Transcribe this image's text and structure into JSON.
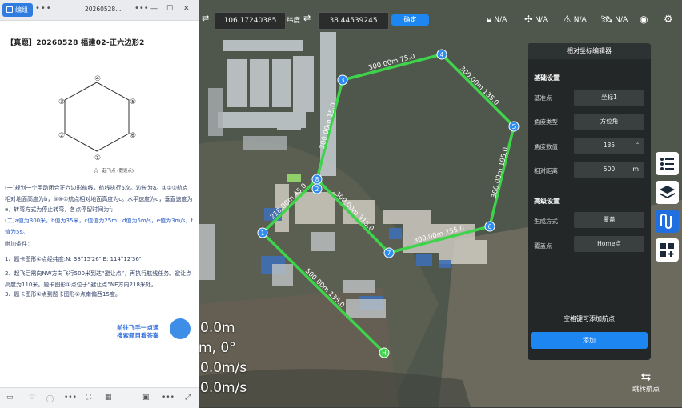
{
  "window": {
    "title": "20260528...",
    "edit_button": "编组",
    "menu_dots": "•••",
    "more_dots": "•••"
  },
  "doc": {
    "title": "【真题】20260528 福建02-正六边形2",
    "hex_labels": [
      "④",
      "③",
      "⑤",
      "②",
      "⑥",
      "①"
    ],
    "start_label": "起飞点 (假设点)",
    "para1": "(一)规划一个手动闭合正六边形航线，航线执行5次。边长为a。①②③航点相对地面高度为b，⑤⑥①航点相对地面高度为c。水平速度为d，垂直速度为e，转弯方式为停止转弯，各点停留时间为f;",
    "para2": "(二)a值为300米，b值为35米，c值值为25m，d值为5m/s，e值为3m/s，f值为5s。",
    "para3": "附加条件：",
    "para4": "1、题卡图形①点经纬度:N: 38°15′26″ E: 114°12′36″",
    "para5": "2、起飞后需向NW方向飞行500米到达“避让点”，再执行航线任务。避让点高度为110米。题卡图形①点位于“避让点”NE方向218米处。",
    "para6": "3、题卡图形①点到题卡图形②点南偏西15度。",
    "promo1": "前往飞手一点通",
    "promo2": "搜索题目看答案"
  },
  "topbar": {
    "longitude": "106.17240385",
    "latitude_label": "纬度",
    "latitude": "38.44539245",
    "confirm": "确定",
    "status": [
      "N/A",
      "N/A",
      "N/A",
      "N/A"
    ]
  },
  "editor": {
    "title": "相对坐标编辑器",
    "basic": "基础设置",
    "ref_label": "基准点",
    "ref_value": "坐标1",
    "angle_type_label": "角度类型",
    "angle_type_value": "方位角",
    "angle_label": "角度数值",
    "angle_value": "135",
    "dist_label": "相对距离",
    "dist_value": "500",
    "dist_unit": "m",
    "advanced": "高级设置",
    "gen_label": "生成方式",
    "gen_value": "覆盖",
    "overlay_label": "覆盖点",
    "overlay_value": "Home点",
    "hint": "空格键可添加航点",
    "add": "添加"
  },
  "hud": {
    "l1": "0.0m",
    "l2": "m, 0°",
    "l3": "0.0m/s",
    "l4": "0.0m/s"
  },
  "jump": "跳转航点",
  "route": {
    "points": [
      {
        "id": "1",
        "x": -18,
        "y": -45
      },
      {
        "id": "2",
        "x": -18,
        "y": -56
      },
      {
        "id": "3",
        "x": -18,
        "y": -63
      },
      {
        "id": "4",
        "x": -18,
        "y": -70
      },
      {
        "id": "5",
        "x": -18,
        "y": -76
      },
      {
        "id": "6",
        "x": -18,
        "y": -81
      },
      {
        "id": "7",
        "x": -18,
        "y": -87
      },
      {
        "id": "8",
        "x": -18,
        "y": -92
      },
      {
        "id": "H",
        "x": -18,
        "y": -97
      }
    ],
    "segments": [
      {
        "label": "300.00m 75.0"
      },
      {
        "label": "300.00m 135.0"
      },
      {
        "label": "300.00m 195.0"
      },
      {
        "label": "300.00m 255.0"
      },
      {
        "label": "300.00m 315.0"
      },
      {
        "label": "218.00m 45.0"
      },
      {
        "label": "300.00m 15.0"
      },
      {
        "label": "500.00m 135.0"
      }
    ],
    "colors": {
      "line": "#3fd34b",
      "point": "#2f8cf0",
      "home": "#3fd34b"
    }
  }
}
